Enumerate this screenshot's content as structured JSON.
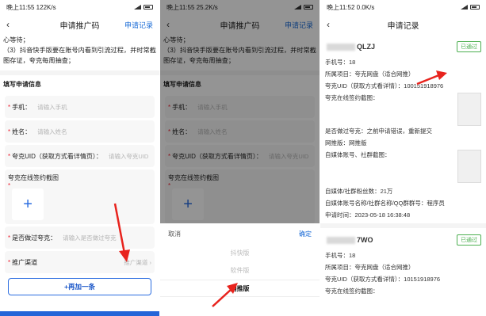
{
  "p1": {
    "status": {
      "time": "晚上11:55",
      "net": "122K/s"
    },
    "title": "申请推广码",
    "record": "申请记录",
    "notice": [
      "心等待；",
      "（3）抖音快手版要在账号内看到引流过程，并时常截图存证，夸克每周抽查；"
    ],
    "section": "填写申请信息",
    "phone": {
      "label": "手机：",
      "ph": "请输入手机"
    },
    "name": {
      "label": "姓名：",
      "ph": "请输入姓名"
    },
    "uid": {
      "label": "夸克UID（获取方式看详情页）：",
      "ph": "请输入夸克UID"
    },
    "shot": {
      "label": "夸克在线签约截图"
    },
    "quark": {
      "label": "是否做过夸克：",
      "ph": "请输入是否做过夸克"
    },
    "channel": {
      "label": "推广渠道",
      "value": "推广渠道 ›"
    },
    "add": "+再加一条"
  },
  "p2": {
    "status": {
      "time": "晚上11:55",
      "net": "25.2K/s"
    },
    "title": "申请推广码",
    "record": "申请记录",
    "notice": [
      "心等待；",
      "（3）抖音快手版要在账号内看到引流过程，并时常截图存证，夸克每周抽查；"
    ],
    "section": "填写申请信息",
    "phone": {
      "label": "手机：",
      "ph": "请输入手机"
    },
    "name": {
      "label": "姓名：",
      "ph": "请输入姓名"
    },
    "uid": {
      "label": "夸克UID（获取方式看详情页）：",
      "ph": "请输入夸克UID"
    },
    "shot": {
      "label": "夸克在线签约截图"
    },
    "cancel": "取消",
    "ok": "确定",
    "options": [
      "抖快版",
      "软件版",
      "网推版"
    ]
  },
  "p3": {
    "status": {
      "time": "晚上11:52",
      "net": "0.0K/s"
    },
    "title": "申请记录",
    "c1": {
      "name": "QLZJ",
      "badge": "已通过",
      "phone": "手机号：18",
      "project": "所属项目：夸克网盘（适合网推）",
      "uid": "夸克UID（获取方式看详情）：100151918976",
      "shot": "夸克在线签约截图：",
      "done": "是否做过夸克：之前申请错误，重新提交",
      "ver": "网推版：网推版",
      "media": "自媒体账号、社群截图：",
      "fans": "自媒体/社群粉丝数：21万",
      "acct": "自媒体账号名称/社群名称/QQ群群号：程序员",
      "time": "申请时间：2023-05-18 16:38:48"
    },
    "c2": {
      "name": "7WO",
      "badge": "已通过",
      "phone": "手机号：18",
      "project": "所属项目：夸克网盘（适合网推）",
      "uid": "夸克UID（获取方式看详情）：10151918976",
      "shot": "夸克在线签约截图："
    }
  }
}
